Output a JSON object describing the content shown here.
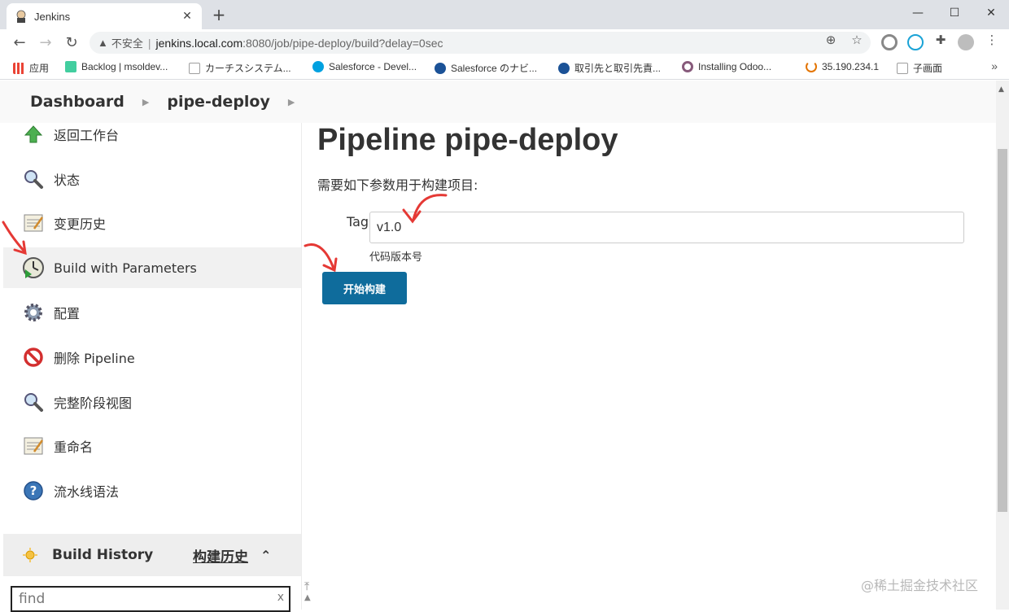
{
  "browser": {
    "tab_title": "Jenkins",
    "new_tab": "+",
    "url_insecure": "不安全",
    "url_host": "jenkins.local.com",
    "url_path": ":8080/job/pipe-deploy/build?delay=0sec",
    "bookmarks": [
      {
        "label": "应用",
        "color": "#4285f4"
      },
      {
        "label": "Backlog | msoldev...",
        "color": "#42ce9f"
      },
      {
        "label": "カーチスシステム...",
        "color": "#9e9e9e"
      },
      {
        "label": "Salesforce - Devel...",
        "color": "#00a1e0"
      },
      {
        "label": "Salesforce のナビ...",
        "color": "#1b5297"
      },
      {
        "label": "取引先と取引先責...",
        "color": "#1b5297"
      },
      {
        "label": "Installing Odoo...",
        "color": "#875a7b"
      },
      {
        "label": "35.190.234.1",
        "color": "#e37400"
      },
      {
        "label": "子画面",
        "color": "#9e9e9e"
      }
    ],
    "bookmarks_more": "»"
  },
  "breadcrumbs": [
    "Dashboard",
    "pipe-deploy"
  ],
  "sidebar": {
    "tasks": [
      {
        "label": "返回工作台",
        "icon": "up-arrow-icon"
      },
      {
        "label": "状态",
        "icon": "search-icon"
      },
      {
        "label": "变更历史",
        "icon": "notepad-icon"
      },
      {
        "label": "Build with Parameters",
        "icon": "clock-icon"
      },
      {
        "label": "配置",
        "icon": "gear-icon"
      },
      {
        "label": "删除 Pipeline",
        "icon": "no-entry-icon"
      },
      {
        "label": "完整阶段视图",
        "icon": "search-icon"
      },
      {
        "label": "重命名",
        "icon": "notepad-icon"
      },
      {
        "label": "流水线语法",
        "icon": "help-icon"
      }
    ],
    "build_history": {
      "title": "Build History",
      "title_cn": "构建历史",
      "toggle": "⌃",
      "find_placeholder": "find",
      "find_clear": "x"
    }
  },
  "main": {
    "title": "Pipeline pipe-deploy",
    "description": "需要如下参数用于构建项目:",
    "param": {
      "name": "Tag",
      "value": "v1.0",
      "description": "代码版本号"
    },
    "build_button": "开始构建"
  },
  "watermark": "@稀土掘金技术社区",
  "colors": {
    "primary_button": "#0f6c9c",
    "annotation": "#e53935"
  }
}
